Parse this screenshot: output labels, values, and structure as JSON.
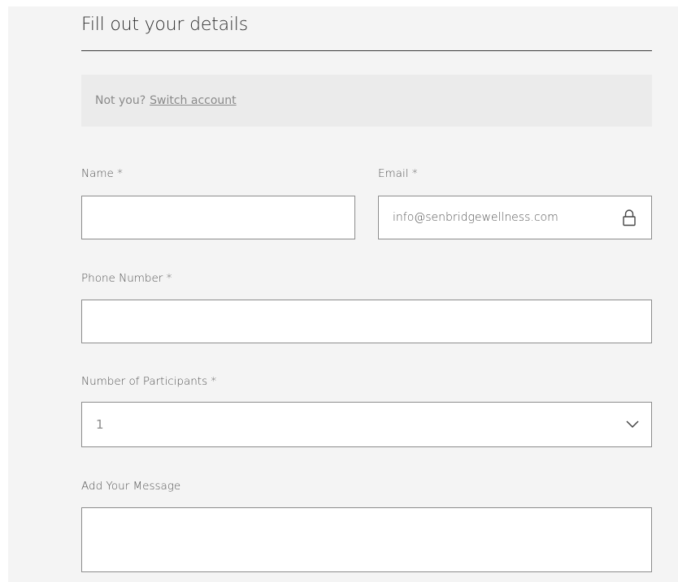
{
  "form": {
    "title": "Fill out your details",
    "notice": {
      "prefix": "Not you?",
      "link_label": "Switch account"
    },
    "fields": {
      "name": {
        "label": "Name *",
        "value": ""
      },
      "email": {
        "label": "Email *",
        "value": "info@senbridgewellness.com",
        "icon": "lock-icon"
      },
      "phone": {
        "label": "Phone Number *",
        "value": ""
      },
      "participants": {
        "label": "Number of Participants *",
        "selected": "1",
        "icon": "chevron-down-icon"
      },
      "message": {
        "label": "Add Your Message",
        "value": ""
      }
    }
  },
  "colors": {
    "panel_bg": "#f4f4f4",
    "notice_bg": "#ebebeb",
    "border": "#8c8c8c",
    "text": "#2b2b2b"
  }
}
